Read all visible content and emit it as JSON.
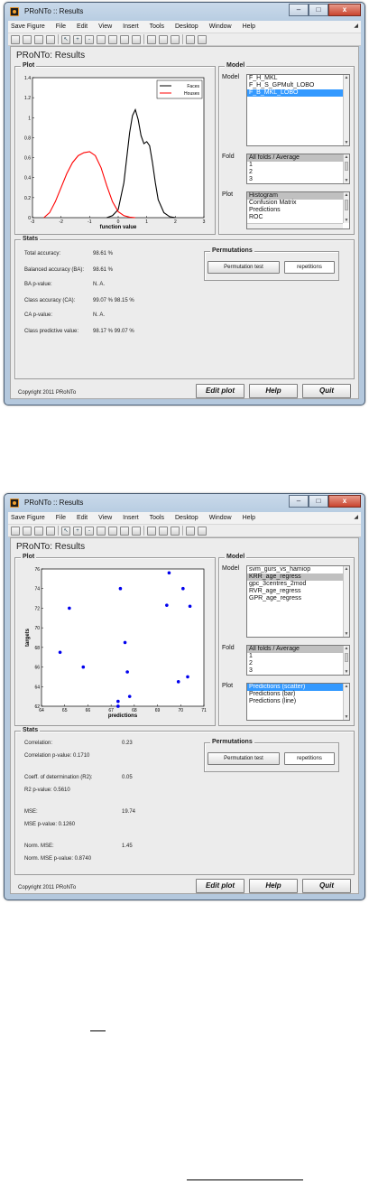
{
  "window_title": "PRoNTo :: Results",
  "menu": [
    "Save Figure",
    "File",
    "Edit",
    "View",
    "Insert",
    "Tools",
    "Desktop",
    "Window",
    "Help"
  ],
  "figure_title": "PRoNTo: Results",
  "panels": {
    "plot": "Plot",
    "model": "Model",
    "stats": "Stats",
    "permutations": "Permutations"
  },
  "labels": {
    "model": "Model",
    "fold": "Fold",
    "plot": "Plot"
  },
  "buttons": {
    "permutation_test": "Permutation test",
    "repetitions": "repetitions",
    "edit_plot": "Edit plot",
    "help": "Help",
    "quit": "Quit"
  },
  "copyright": "Copyright 2011 PRoNTo",
  "window_controls": {
    "minimize": "–",
    "maximize": "□",
    "close": "x"
  },
  "screen1": {
    "model_list": [
      "F_H_MKL",
      "F_H_S_GPMult_LOBO",
      "F_B_MKL_LOBO"
    ],
    "model_selected": 2,
    "fold_list": [
      "All folds / Average",
      "1",
      "2",
      "3"
    ],
    "fold_selected": 0,
    "plot_list": [
      "Histogram",
      "Confusion Matrix",
      "Predictions",
      "ROC"
    ],
    "plot_selected": 0,
    "stats": [
      {
        "label": "Total accuracy:",
        "value": "98.61 %"
      },
      {
        "label": "Balanced accuracy (BA):",
        "value": "98.61 %"
      },
      {
        "label": "BA p-value:",
        "value": "N. A."
      },
      {
        "label": "Class accuracy (CA):",
        "value": "99.07 %  98.15 %"
      },
      {
        "label": "CA p-value:",
        "value": "N. A."
      },
      {
        "label": "Class predictive value:",
        "value": "98.17 %  99.07 %"
      }
    ]
  },
  "screen2": {
    "model_list": [
      "svm_gurs_vs_hamiop",
      "KRR_age_regress",
      "gpc_3centres_2mod",
      "RVR_age_regress",
      "GPR_age_regress"
    ],
    "model_selected": 1,
    "fold_list": [
      "All folds / Average",
      "1",
      "2",
      "3"
    ],
    "fold_selected": 0,
    "plot_list": [
      "Predictions (scatter)",
      "Predictions (bar)",
      "Predictions (line)"
    ],
    "plot_selected": 0,
    "stats": [
      {
        "label": "Correlation:",
        "value": "0.23"
      },
      {
        "label": "Correlation p-value: 0.1710",
        "value": ""
      },
      {
        "label": "Coeff. of determination (R2):",
        "value": "0.05"
      },
      {
        "label": "R2 p-value: 0.5610",
        "value": ""
      },
      {
        "label": "MSE:",
        "value": "19.74"
      },
      {
        "label": "MSE p-value: 0.1260",
        "value": ""
      },
      {
        "label": "Norm. MSE:",
        "value": "1.45"
      },
      {
        "label": "Norm. MSE p-value: 0.8740",
        "value": ""
      }
    ]
  },
  "chart_data": [
    {
      "type": "line",
      "xlabel": "function value",
      "ylabel": "",
      "xlim": [
        -3,
        3
      ],
      "ylim": [
        0,
        1.4
      ],
      "xticks": [
        -3,
        -2,
        -1,
        0,
        1,
        2,
        3
      ],
      "yticks": [
        0,
        0.2,
        0.4,
        0.6,
        0.8,
        1,
        1.2,
        1.4
      ],
      "legend_position": "top-right",
      "series": [
        {
          "name": "Faces",
          "color": "#000000",
          "x": [
            -0.4,
            -0.2,
            0,
            0.2,
            0.4,
            0.5,
            0.6,
            0.7,
            0.8,
            0.9,
            1.0,
            1.1,
            1.2,
            1.3,
            1.4,
            1.6,
            1.8,
            2.0
          ],
          "y": [
            0.0,
            0.02,
            0.08,
            0.35,
            0.85,
            1.02,
            1.08,
            0.98,
            0.82,
            0.74,
            0.76,
            0.72,
            0.55,
            0.35,
            0.18,
            0.05,
            0.01,
            0.0
          ]
        },
        {
          "name": "Houses",
          "color": "#ff0000",
          "x": [
            -2.6,
            -2.4,
            -2.2,
            -2.0,
            -1.8,
            -1.6,
            -1.4,
            -1.2,
            -1.0,
            -0.8,
            -0.6,
            -0.4,
            -0.2,
            0,
            0.2,
            0.4,
            0.6
          ],
          "y": [
            0.0,
            0.05,
            0.16,
            0.3,
            0.44,
            0.55,
            0.62,
            0.65,
            0.66,
            0.62,
            0.5,
            0.32,
            0.16,
            0.06,
            0.02,
            0.005,
            0.0
          ]
        }
      ]
    },
    {
      "type": "scatter",
      "xlabel": "predictions",
      "ylabel": "targets",
      "xlim": [
        64,
        71
      ],
      "ylim": [
        62,
        76
      ],
      "xticks": [
        64,
        65,
        66,
        67,
        68,
        69,
        70,
        71
      ],
      "yticks": [
        62,
        64,
        66,
        68,
        70,
        72,
        74,
        76
      ],
      "series": [
        {
          "name": "",
          "color": "#0000ee",
          "x": [
            64.8,
            65.2,
            65.8,
            67.3,
            67.4,
            67.6,
            67.7,
            67.8,
            67.3,
            67.3,
            69.4,
            69.5,
            69.9,
            70.1,
            70.3,
            70.4
          ],
          "y": [
            67.5,
            72.0,
            66.0,
            62.5,
            74.0,
            68.5,
            65.5,
            63.0,
            62.0,
            62.0,
            72.3,
            75.6,
            64.5,
            74.0,
            65.0,
            72.2
          ]
        }
      ]
    }
  ]
}
